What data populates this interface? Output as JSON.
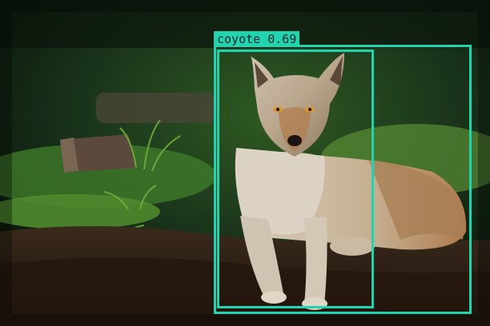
{
  "colors": {
    "box": "#22d3b0",
    "label_bg": "#22d3b0",
    "label_text": "#0a2a26"
  },
  "detections": [
    {
      "label": "coyote 0.69"
    }
  ]
}
